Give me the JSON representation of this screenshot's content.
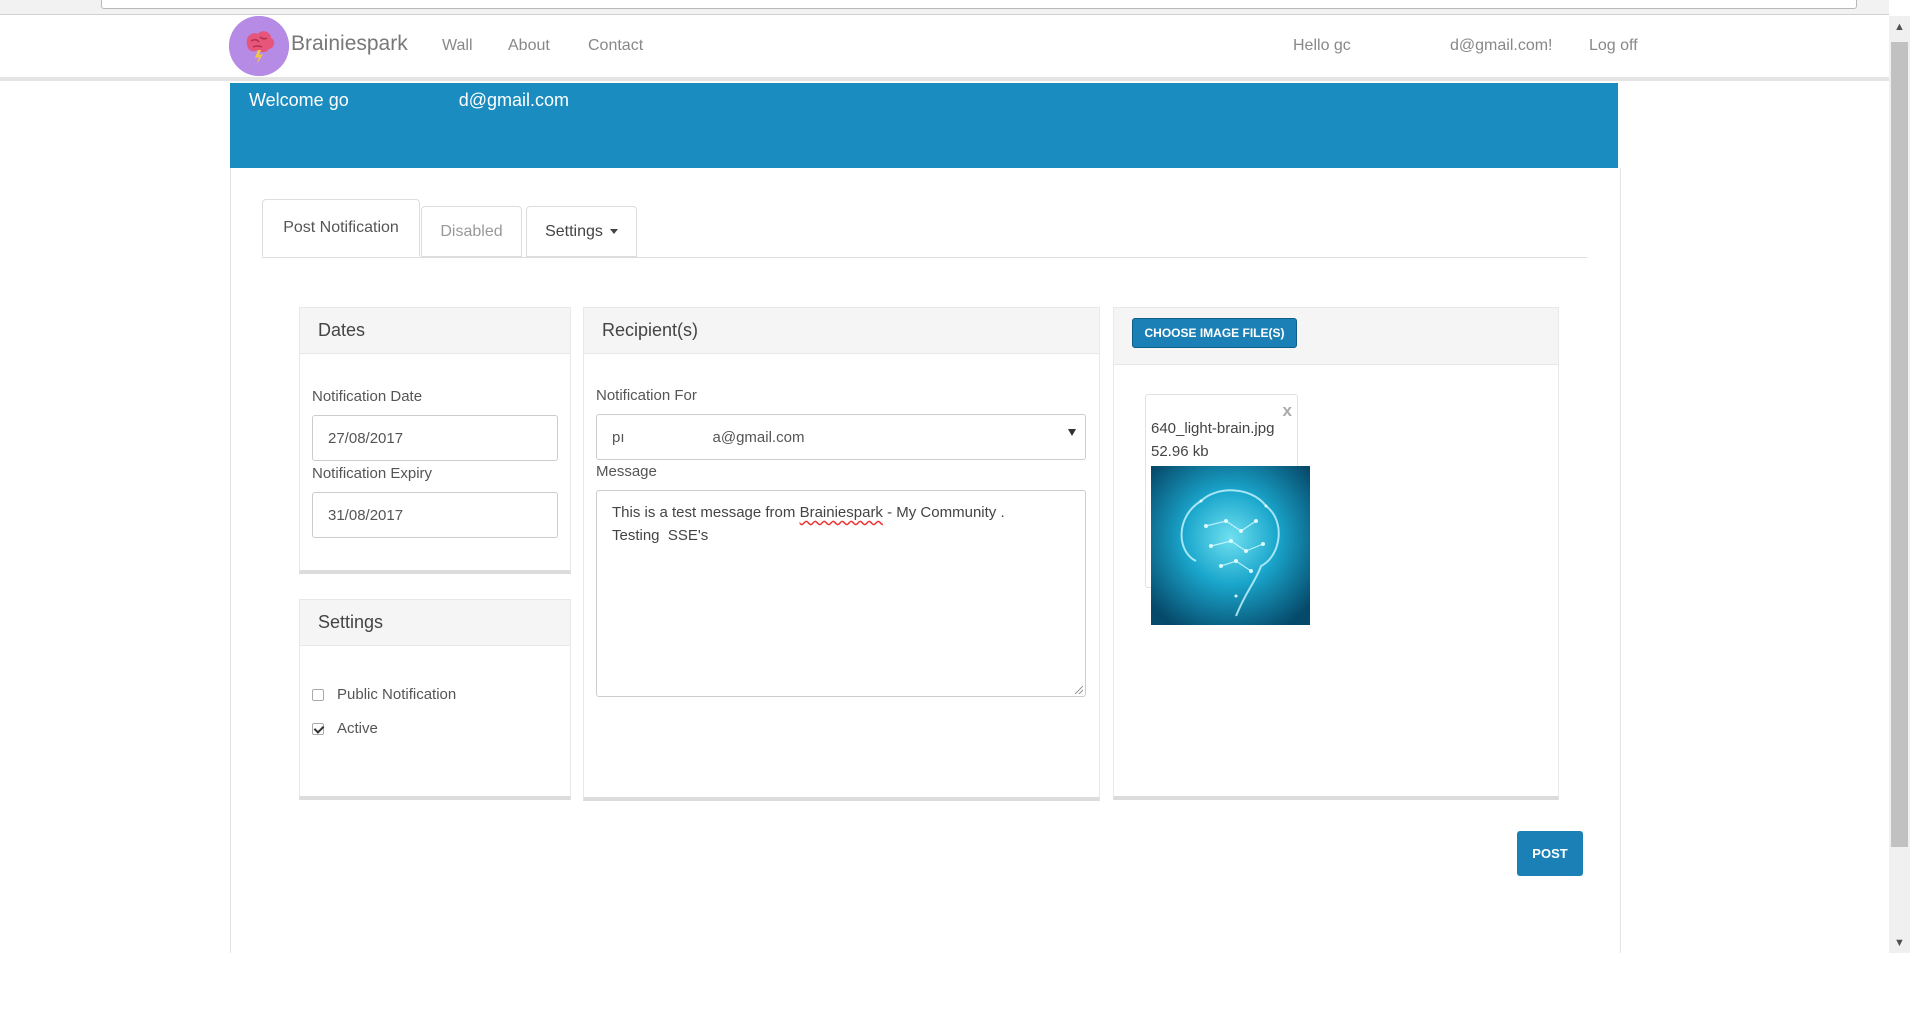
{
  "navbar": {
    "brand": "Brainiespark",
    "links": [
      "Wall",
      "About",
      "Contact"
    ],
    "greeting": "Hello gc",
    "user_email": "d@gmail.com!",
    "logoff": "Log off"
  },
  "welcome": {
    "prefix": "Welcome go",
    "email": "d@gmail.com"
  },
  "tabs": {
    "post_notification": "Post Notification",
    "disabled": "Disabled",
    "settings": "Settings"
  },
  "dates_panel": {
    "title": "Dates",
    "notification_date_label": "Notification Date",
    "notification_date_value": "27/08/2017",
    "notification_expiry_label": "Notification Expiry",
    "notification_expiry_value": "31/08/2017"
  },
  "settings_panel": {
    "title": "Settings",
    "public_notification_label": "Public Notification",
    "public_notification_checked": false,
    "active_label": "Active",
    "active_checked": true
  },
  "recipients_panel": {
    "title": "Recipient(s)",
    "notification_for_label": "Notification For",
    "notification_for_prefix": "pı",
    "notification_for_email": "a@gmail.com",
    "message_label": "Message",
    "message_line1_start": "This is a test message from ",
    "message_line1_misspelled": "Brainiespark",
    "message_line1_end": " - My Community .",
    "message_line2": "Testing  SSE's"
  },
  "image_panel": {
    "choose_button": "CHOOSE IMAGE FILE(S)",
    "file_name": "640_light-brain.jpg",
    "file_size": "52.96 kb",
    "remove": "x"
  },
  "post_button": "POST",
  "colors": {
    "primary": "#1a8cbf",
    "button": "#1a80b5",
    "logo": "#b58be6"
  },
  "icons": [
    "brain-logo-icon",
    "caret-down-icon",
    "checkbox-icon",
    "select-arrow-icon",
    "close-icon",
    "resize-grip-icon"
  ]
}
